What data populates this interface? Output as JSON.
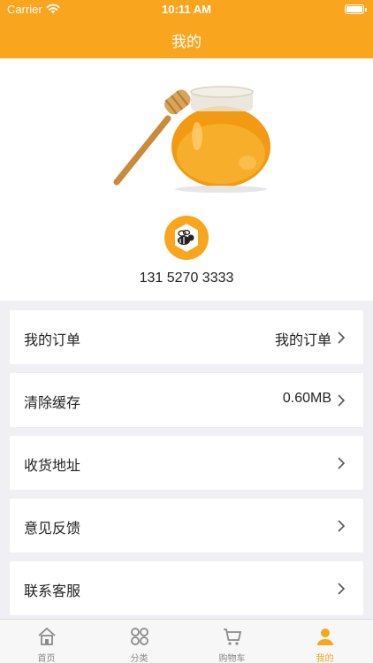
{
  "status_bar": {
    "carrier": "Carrier",
    "time": "10:11 AM",
    "battery_level": 1.0
  },
  "nav": {
    "title": "我的"
  },
  "profile": {
    "phone": "131 5270 3333"
  },
  "menu": [
    {
      "label": "我的订单",
      "value": "我的订单"
    },
    {
      "label": "清除缓存",
      "value": "0.60MB"
    },
    {
      "label": "收货地址",
      "value": ""
    },
    {
      "label": "意见反馈",
      "value": ""
    },
    {
      "label": "联系客服",
      "value": ""
    }
  ],
  "tabs": [
    {
      "label": "首页",
      "icon": "home-icon",
      "active": false
    },
    {
      "label": "分类",
      "icon": "category-icon",
      "active": false
    },
    {
      "label": "购物车",
      "icon": "cart-icon",
      "active": false
    },
    {
      "label": "我的",
      "icon": "profile-icon",
      "active": true
    }
  ],
  "colors": {
    "accent": "#f9a51e",
    "background": "#efeff4",
    "tab_inactive": "#888888"
  }
}
